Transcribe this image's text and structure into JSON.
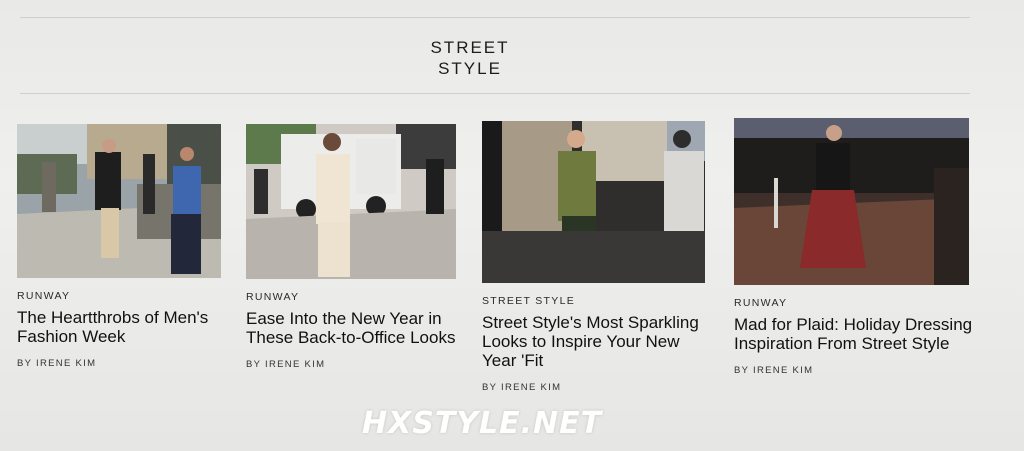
{
  "section": {
    "title_line1": "STREET",
    "title_line2": "STYLE"
  },
  "articles": [
    {
      "kicker": "RUNWAY",
      "title": "The Heartthrobs of Men's Fashion Week",
      "byline": "BY IRENE KIM"
    },
    {
      "kicker": "RUNWAY",
      "title": "Ease Into the New Year in These Back-to-Office Looks",
      "byline": "BY IRENE KIM"
    },
    {
      "kicker": "STREET STYLE",
      "title": "Street Style's Most Sparkling Looks to Inspire Your New Year 'Fit",
      "byline": "BY IRENE KIM"
    },
    {
      "kicker": "RUNWAY",
      "title": "Mad for Plaid: Holiday Dressing Inspiration From Street Style",
      "byline": "BY IRENE KIM"
    }
  ],
  "watermark": "HXSTYLE.NET"
}
